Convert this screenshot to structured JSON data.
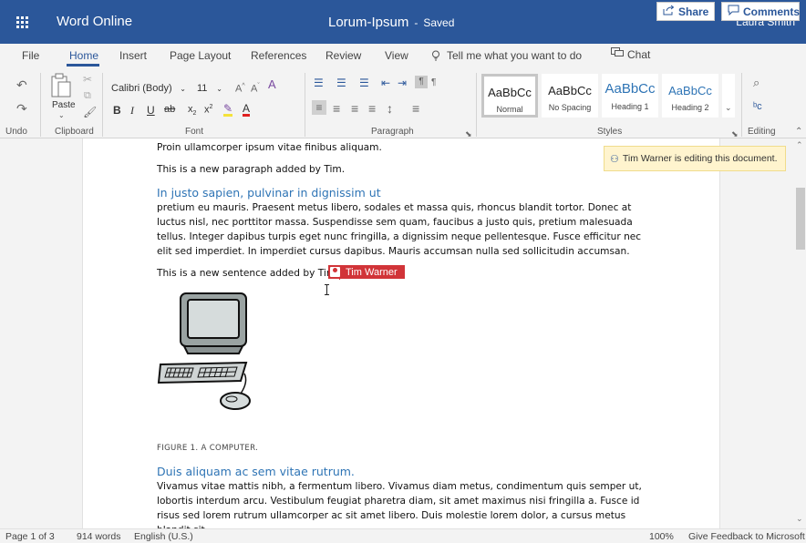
{
  "app": {
    "name": "Word Online",
    "doc_title": "Lorum-Ipsum",
    "separator": "-",
    "save_status": "Saved",
    "user": "Laura Smith"
  },
  "tabs": [
    "File",
    "Home",
    "Insert",
    "Page Layout",
    "References",
    "Review",
    "View"
  ],
  "active_tab": "Home",
  "tell_me": "Tell me what you want to do",
  "header_actions": {
    "chat": "Chat",
    "share": "Share",
    "comments": "Comments"
  },
  "ribbon": {
    "groups": {
      "undo": "Undo",
      "clipboard": "Clipboard",
      "font": "Font",
      "paragraph": "Paragraph",
      "styles": "Styles",
      "editing": "Editing"
    },
    "paste_label": "Paste",
    "font_name": "Calibri (Body)",
    "font_size": "11",
    "styles": [
      {
        "sample": "AaBbCc",
        "name": "Normal"
      },
      {
        "sample": "AaBbCc",
        "name": "No Spacing"
      },
      {
        "sample": "AaBbCc",
        "name": "Heading 1"
      },
      {
        "sample": "AaBbCc",
        "name": "Heading 2"
      }
    ],
    "selected_style": "Normal"
  },
  "document": {
    "p1": "Proin ullamcorper ipsum vitae finibus aliquam.",
    "p2": "This is a new paragraph added by Tim.",
    "heading1": "In justo sapien, pulvinar in dignissim ut",
    "body1": " pretium eu mauris. Praesent metus libero, sodales et massa quis, rhoncus blandit tortor. Donec at luctus nisl, nec porttitor massa. Suspendisse sem quam, faucibus a justo quis, pretium malesuada tellus. Integer dapibus turpis eget nunc fringilla, a dignissim neque pellentesque. Fusce efficitur nec elit sed imperdiet. In imperdiet cursus dapibus. Mauris accumsan nulla sed sollicitudin accumsan.",
    "p3": "This is a new sentence added by Tim.",
    "caption": "FIGURE 1. A COMPUTER.",
    "heading2": "Duis aliquam ac sem vitae rutrum.",
    "body2": "Vivamus vitae mattis nibh, a fermentum libero. Vivamus diam metus, condimentum quis semper ut, lobortis interdum arcu. Vestibulum feugiat pharetra diam, sit amet maximus nisi fringilla a. Fusce id risus sed lorem rutrum ullamcorper ac sit amet libero. Duis molestie lorem dolor, a cursus metus blandit sit",
    "coauthor_flag": "Tim Warner",
    "notice": "Tim Warner is editing this document."
  },
  "statusbar": {
    "page": "Page 1 of 3",
    "words": "914 words",
    "language": "English (U.S.)",
    "zoom": "100%",
    "feedback": "Give Feedback to Microsoft"
  }
}
